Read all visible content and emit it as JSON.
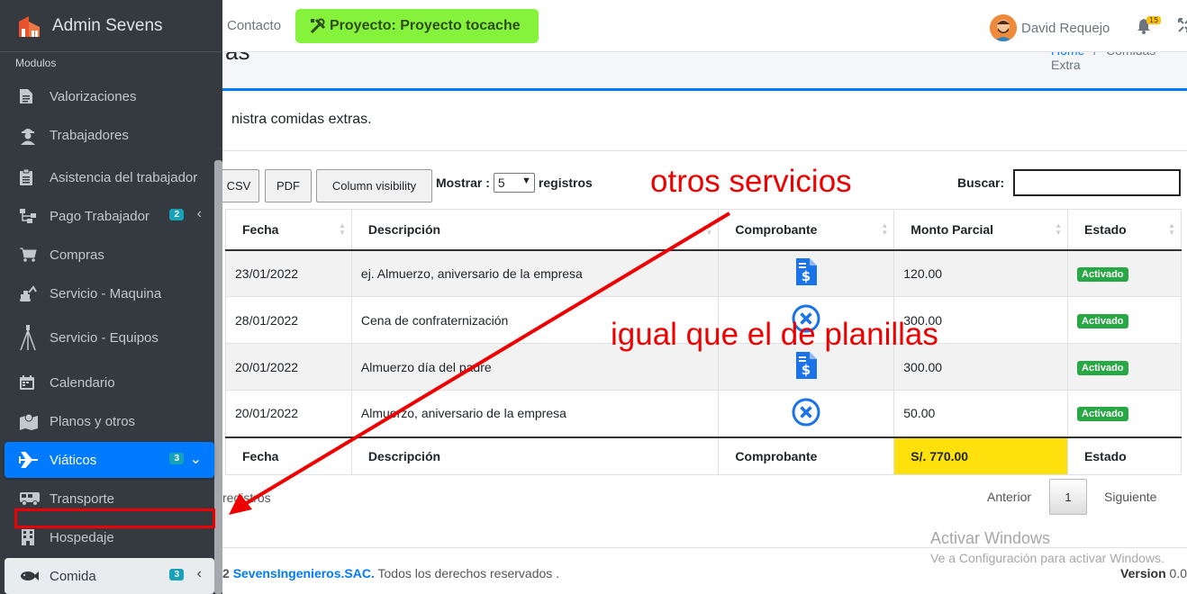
{
  "brand": {
    "title": "Admin Sevens"
  },
  "sidebar": {
    "header": "Modulos",
    "items": [
      {
        "label": "Valorizaciones",
        "icon": "file-icon"
      },
      {
        "label": "Trabajadores",
        "icon": "worker-icon"
      },
      {
        "label": "Asistencia del trabajador",
        "icon": "clipboard-icon"
      },
      {
        "label": "Pago Trabajador",
        "icon": "sitemap-icon",
        "badge": "2"
      },
      {
        "label": "Compras",
        "icon": "cart-icon"
      },
      {
        "label": "Servicio - Maquina",
        "icon": "excavator-icon"
      },
      {
        "label": "Servicio - Equipos",
        "icon": "tripod-icon"
      },
      {
        "label": "Calendario",
        "icon": "calendar-icon"
      },
      {
        "label": "Planos y otros",
        "icon": "map-icon"
      },
      {
        "label": "Viáticos",
        "icon": "plane-icon",
        "badge": "3"
      },
      {
        "label": "Transporte",
        "icon": "bus-icon"
      },
      {
        "label": "Hospedaje",
        "icon": "building-icon"
      },
      {
        "label": "Comida",
        "icon": "fish-icon",
        "badge": "3"
      }
    ]
  },
  "topbar": {
    "contact": "Contacto",
    "project": "Proyecto: Proyecto tocache",
    "user": "David Requejo",
    "notifications": "15"
  },
  "content": {
    "title": "as",
    "breadcrumb_home": "Home",
    "breadcrumb_sep": "/",
    "breadcrumb_current": "Comidas Extra",
    "description": "nistra comidas extras."
  },
  "toolbar": {
    "csv": "CSV",
    "pdf": "PDF",
    "column_visibility": "Column visibility",
    "show_label": "Mostrar :",
    "show_value": "5",
    "records_label": "registros",
    "search_label": "Buscar:"
  },
  "table": {
    "columns": [
      "Fecha",
      "Descripción",
      "Comprobante",
      "Monto Parcial",
      "Estado"
    ],
    "rows": [
      {
        "fecha": "23/01/2022",
        "descripcion": "ej. Almuerzo, aniversario de la empresa",
        "comprobante": "receipt",
        "monto": "120.00",
        "estado": "Activado"
      },
      {
        "fecha": "28/01/2022",
        "descripcion": "Cena de confraternización",
        "comprobante": "none",
        "monto": "300.00",
        "estado": "Activado"
      },
      {
        "fecha": "20/01/2022",
        "descripcion": "Almuerzo día del padre",
        "comprobante": "receipt",
        "monto": "300.00",
        "estado": "Activado"
      },
      {
        "fecha": "20/01/2022",
        "descripcion": "Almuerzo, aniversario de la empresa",
        "comprobante": "none",
        "monto": "50.00",
        "estado": "Activado"
      }
    ],
    "footer": {
      "fecha": "Fecha",
      "descripcion": "Descripción",
      "comprobante": "Comprobante",
      "total": "S/. 770.00",
      "estado": "Estado"
    }
  },
  "pagination": {
    "info": "registros",
    "prev": "Anterior",
    "page": "1",
    "next": "Siguiente"
  },
  "footer": {
    "copy_prefix": "2",
    "brand": "SevensIngenieros.SAC.",
    "rights": "Todos los derechos reservados .",
    "version_label": "Version",
    "version_value": "0.0"
  },
  "watermark": {
    "title": "Activar Windows",
    "subtitle": "Ve a Configuración para activar Windows."
  },
  "annotations": {
    "text1": "otros servicios",
    "text2": "igual que el de planillas"
  },
  "colors": {
    "sidebar_bg": "#343a40",
    "active": "#007bff",
    "project_btn": "#85f23c",
    "badge": "#17a2b8",
    "status_active": "#28a745",
    "total_highlight": "#fde00c",
    "annotation": "#ee0000"
  }
}
